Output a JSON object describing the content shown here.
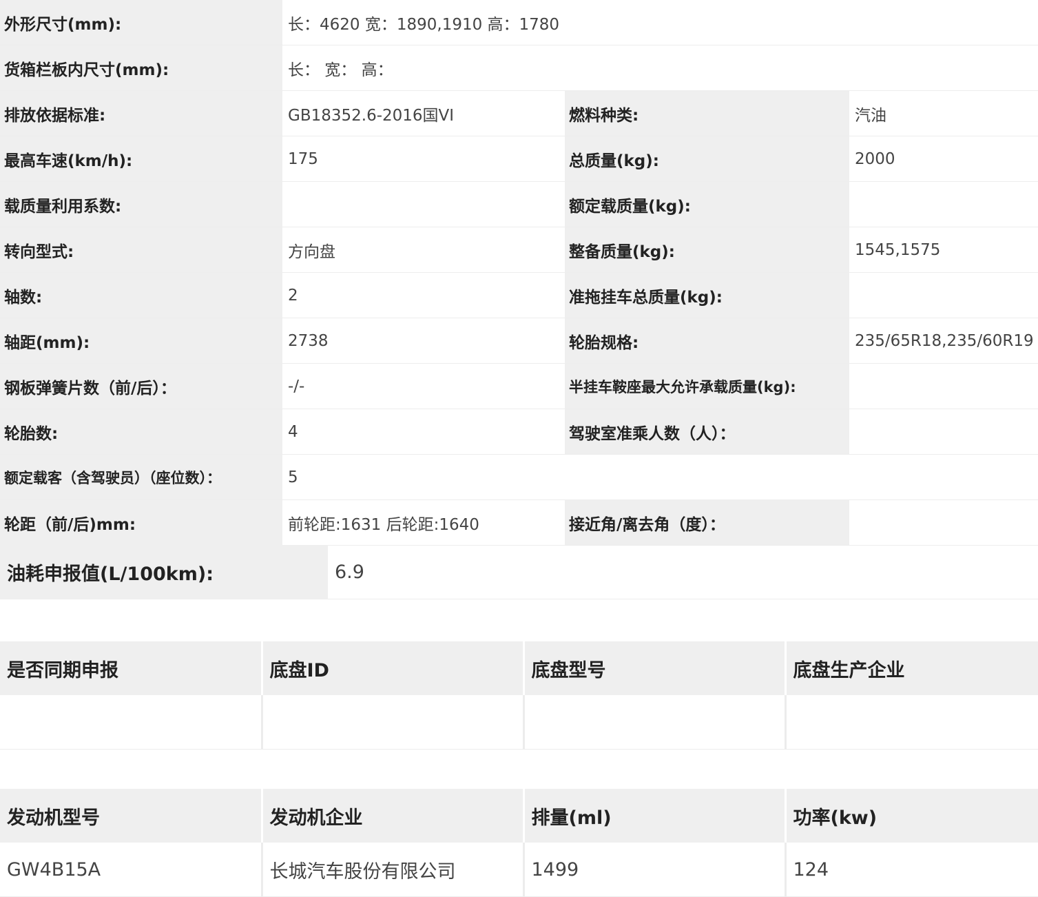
{
  "specs": {
    "dimensions": {
      "label": "外形尺寸(mm):",
      "value": "长：4620 宽：1890,1910 高：1780"
    },
    "cargo_box": {
      "label": "货箱栏板内尺寸(mm):",
      "value": "长： 宽： 高："
    },
    "emission_standard": {
      "label": "排放依据标准:",
      "value": "GB18352.6-2016国VI"
    },
    "fuel_type": {
      "label": "燃料种类:",
      "value": "汽油"
    },
    "max_speed": {
      "label": "最高车速(km/h):",
      "value": "175"
    },
    "total_mass": {
      "label": "总质量(kg):",
      "value": "2000"
    },
    "load_utilization": {
      "label": "载质量利用系数:",
      "value": ""
    },
    "rated_load": {
      "label": "额定载质量(kg):",
      "value": ""
    },
    "steering": {
      "label": "转向型式:",
      "value": "方向盘"
    },
    "curb_weight": {
      "label": "整备质量(kg):",
      "value": "1545,1575"
    },
    "axles": {
      "label": "轴数:",
      "value": "2"
    },
    "trailer_mass": {
      "label": "准拖挂车总质量(kg):",
      "value": ""
    },
    "wheelbase": {
      "label": "轴距(mm):",
      "value": "2738"
    },
    "tire_spec": {
      "label": "轮胎规格:",
      "value": "235/65R18,235/60R19"
    },
    "leaf_springs": {
      "label": "钢板弹簧片数（前/后）：",
      "value": "-/-"
    },
    "saddle_load": {
      "label": "半挂车鞍座最大允许承载质量(kg):",
      "value": ""
    },
    "tire_count": {
      "label": "轮胎数:",
      "value": "4"
    },
    "cab_passengers": {
      "label": "驾驶室准乘人数（人）：",
      "value": ""
    },
    "rated_passengers": {
      "label": "额定载客（含驾驶员）（座位数）：",
      "value": "5"
    },
    "track": {
      "label": "轮距（前/后)mm:",
      "value": "前轮距:1631 后轮距:1640"
    },
    "angles": {
      "label": "接近角/离去角（度）：",
      "value": ""
    }
  },
  "fuel": {
    "label": "油耗申报值(L/100km):",
    "value": "6.9"
  },
  "chassis": {
    "headers": [
      "是否同期申报",
      "底盘ID",
      "底盘型号",
      "底盘生产企业"
    ],
    "row": [
      "",
      "",
      "",
      ""
    ]
  },
  "engine": {
    "headers": [
      "发动机型号",
      "发动机企业",
      "排量(ml)",
      "功率(kw)"
    ],
    "row": [
      "GW4B15A",
      "长城汽车股份有限公司",
      "1499",
      "124"
    ]
  }
}
